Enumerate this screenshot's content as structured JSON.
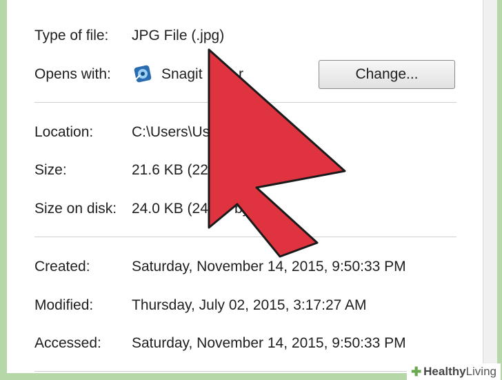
{
  "properties": {
    "type_label": "Type of file:",
    "type_value": "JPG File (.jpg)",
    "opens_label": "Opens with:",
    "opens_value": "Snagit",
    "opens_value_tail": "r",
    "change_button": "Change...",
    "location_label": "Location:",
    "location_value": "C:\\Users\\Us",
    "size_label": "Size:",
    "size_value": "21.6 KB (22",
    "size_disk_label": "Size on disk:",
    "size_disk_value": "24.0 KB (24",
    "size_disk_tail": "byte",
    "created_label": "Created:",
    "created_value": "Saturday, November 14, 2015, 9:50:33 PM",
    "modified_label": "Modified:",
    "modified_value": "Thursday, July 02, 2015, 3:17:27 AM",
    "accessed_label": "Accessed:",
    "accessed_value": "Saturday, November 14, 2015, 9:50:33 PM"
  },
  "watermark": {
    "brand_a": "Healthy",
    "brand_b": "Living"
  },
  "colors": {
    "arrow_fill": "#e03340",
    "arrow_stroke": "#1a1a1a",
    "frame": "#b6d7a8",
    "accent": "#6aa84f"
  },
  "icons": {
    "app": "snagit-editor-icon",
    "pointer": "cursor-arrow-icon"
  }
}
